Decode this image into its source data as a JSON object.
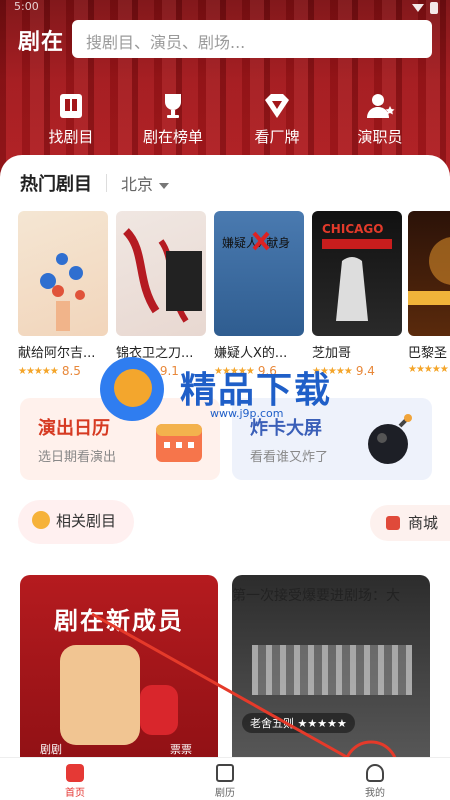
{
  "statusbar": {
    "time": "5:00"
  },
  "header": {
    "logo": "剧在",
    "search_placeholder": "搜剧目、演员、剧场..."
  },
  "quick_links": [
    {
      "label": "找剧目",
      "icon": "book-icon"
    },
    {
      "label": "剧在榜单",
      "icon": "trophy-icon"
    },
    {
      "label": "看厂牌",
      "icon": "diamond-icon"
    },
    {
      "label": "演职员",
      "icon": "person-star-icon"
    }
  ],
  "hot": {
    "title": "热门剧目",
    "city": "北京",
    "posters": [
      {
        "title": "献给阿尔吉...",
        "rating": "8.5"
      },
      {
        "title": "锦衣卫之刀...",
        "rating": "9.1"
      },
      {
        "title": "嫌疑人X的...",
        "rating": "9.6"
      },
      {
        "title": "芝加哥",
        "rating": "9.4"
      },
      {
        "title": "巴黎圣",
        "rating": ""
      }
    ]
  },
  "promo": {
    "cal_title": "演出日历",
    "cal_sub": "选日期看演出",
    "bomb_title": "炸卡大屏",
    "bomb_sub": "看看谁又炸了"
  },
  "related": {
    "label": "相关剧目"
  },
  "shop": {
    "label": "商城"
  },
  "feed": {
    "card1_title": "剧在新成员",
    "card1_left": "剧剧",
    "card1_right": "票票",
    "card2_author": "老舍五则 ★★★★★",
    "card2_caption": "第一次接受爆要进剧场：大"
  },
  "nav": [
    {
      "label": "首页"
    },
    {
      "label": "剧历"
    },
    {
      "label": "我的"
    }
  ],
  "watermark": {
    "title": "精品下载",
    "url": "www.j9p.com"
  },
  "colors": {
    "brand_red": "#b11a1e",
    "accent_blue": "#2f7df0"
  }
}
